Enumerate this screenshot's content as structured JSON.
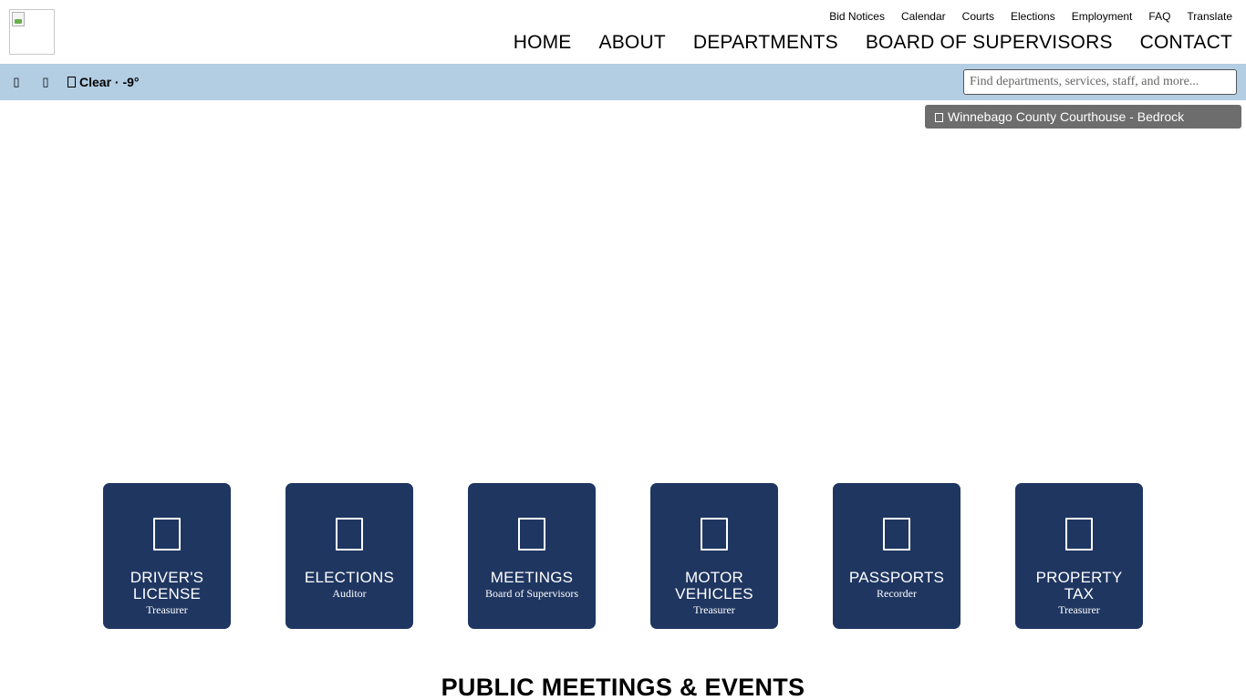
{
  "utility_nav": [
    "Bid Notices",
    "Calendar",
    "Courts",
    "Elections",
    "Employment",
    "FAQ",
    "Translate"
  ],
  "main_nav": [
    "HOME",
    "ABOUT",
    "DEPARTMENTS",
    "BOARD OF SUPERVISORS",
    "CONTACT"
  ],
  "info_bar": {
    "weather": "Clear · -9°",
    "search_placeholder": "Find departments, services, staff, and more..."
  },
  "photo_credit": "Winnebago County Courthouse - Bedrock Productions",
  "tiles": [
    {
      "label_lines": [
        "DRIVER'S",
        "LICENSE"
      ],
      "sub": "Treasurer",
      "icon": "id-card-icon"
    },
    {
      "label_lines": [
        "ELECTIONS"
      ],
      "sub": "Auditor",
      "icon": "ballot-icon"
    },
    {
      "label_lines": [
        "MEETINGS"
      ],
      "sub": "Board of Supervisors",
      "icon": "meeting-icon"
    },
    {
      "label_lines": [
        "MOTOR",
        "VEHICLES"
      ],
      "sub": "Treasurer",
      "icon": "car-icon"
    },
    {
      "label_lines": [
        "PASSPORTS"
      ],
      "sub": "Recorder",
      "icon": "passport-icon"
    },
    {
      "label_lines": [
        "PROPERTY",
        "TAX"
      ],
      "sub": "Treasurer",
      "icon": "house-icon"
    }
  ],
  "section_title": "PUBLIC MEETINGS & EVENTS",
  "colors": {
    "info_bar": "#b3cde3",
    "tile": "#1f3661",
    "credit": "#6d6d6d"
  }
}
